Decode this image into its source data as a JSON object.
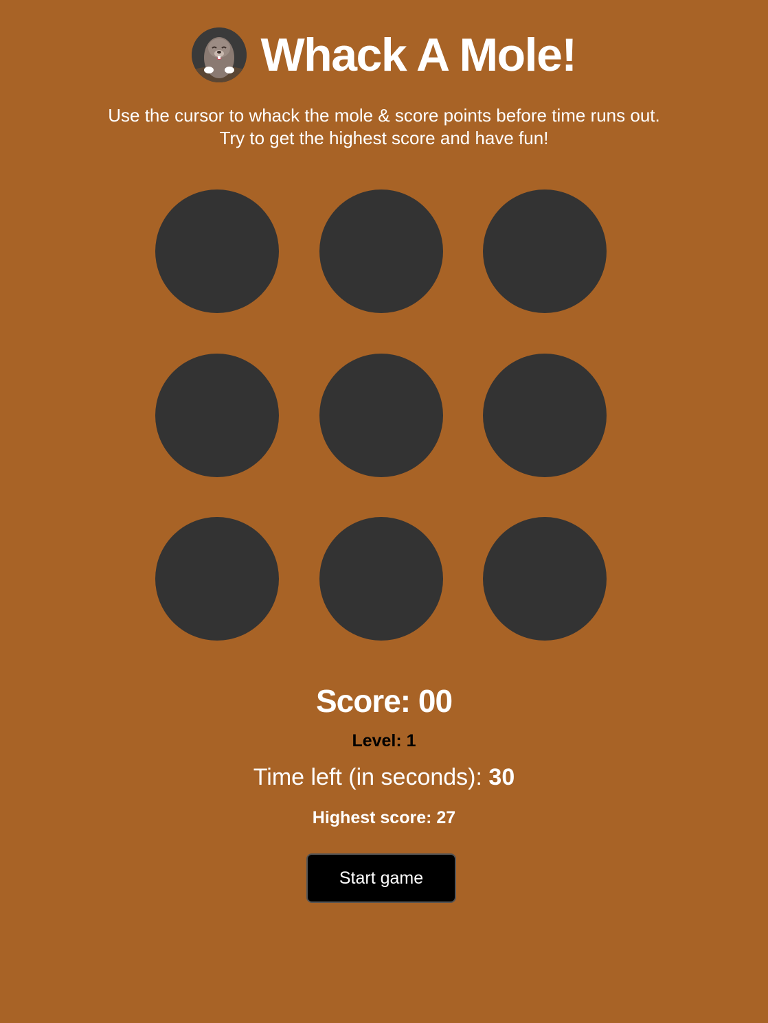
{
  "header": {
    "title": "Whack A Mole!",
    "logo_icon": "mole-icon"
  },
  "instructions": {
    "line1": "Use the cursor to whack the mole & score points before time runs out.",
    "line2": "Try to get the highest score and have fun!"
  },
  "board": {
    "hole_count": 9,
    "hole_color": "#333333"
  },
  "stats": {
    "score_label": "Score:",
    "score_value": "00",
    "level_label": "Level:",
    "level_value": "1",
    "time_label": "Time left (in seconds):",
    "time_value": "30",
    "highscore_label": "Highest score:",
    "highscore_value": "27"
  },
  "controls": {
    "start_label": "Start game"
  },
  "colors": {
    "background": "#a86326",
    "text": "#ffffff",
    "button": "#000000"
  }
}
